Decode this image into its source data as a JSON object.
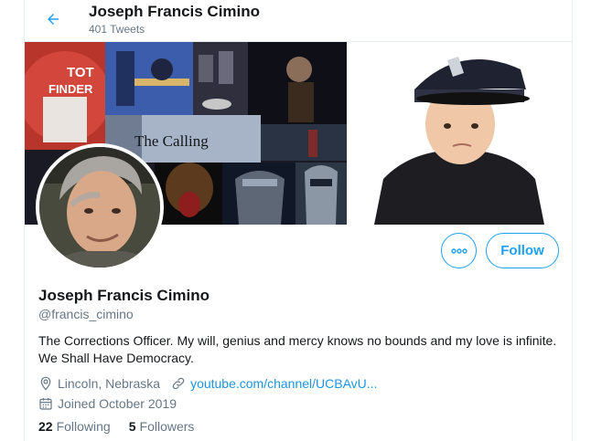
{
  "header": {
    "name": "Joseph Francis Cimino",
    "tweet_count": "401 Tweets"
  },
  "banner": {
    "collage_caption": "The Calling",
    "sign_text": "TOT FINDER"
  },
  "profile": {
    "display_name": "Joseph Francis Cimino",
    "handle": "@francis_cimino",
    "bio": "The Corrections Officer.  My will, genius and mercy knows no bounds and my love is infinite. We Shall Have Democracy.",
    "location": "Lincoln, Nebraska",
    "website": "youtube.com/channel/UCBAvU...",
    "joined": "Joined October 2019",
    "following_count": "22",
    "following_label": "Following",
    "followers_count": "5",
    "followers_label": "Followers"
  },
  "actions": {
    "follow_label": "Follow",
    "more_icon": "more-icon"
  },
  "colors": {
    "accent": "#1da1f2",
    "link": "#1b95e0",
    "secondary_text": "#657786",
    "primary_text": "#14171a"
  }
}
